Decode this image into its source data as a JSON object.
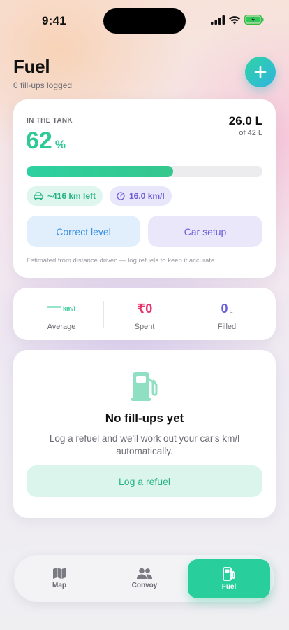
{
  "status_bar": {
    "time": "9:41"
  },
  "header": {
    "title": "Fuel",
    "subtitle": "0 fill-ups logged"
  },
  "tank": {
    "label": "IN THE TANK",
    "percent": "62",
    "percent_unit": "%",
    "liters": "26.0 L",
    "capacity": "of 42 L",
    "fill_fraction": 0.62,
    "range_chip": "~416 km left",
    "efficiency_chip": "16.0 km/l",
    "correct_button": "Correct level",
    "setup_button": "Car setup",
    "note": "Estimated from distance driven — log refuels to keep it accurate."
  },
  "stats": {
    "average": {
      "value": "—",
      "unit": "km/l",
      "label": "Average"
    },
    "spent": {
      "value": "₹0",
      "label": "Spent"
    },
    "filled": {
      "value": "0",
      "unit": "L",
      "label": "Filled"
    }
  },
  "empty_state": {
    "title": "No fill-ups yet",
    "description": "Log a refuel and we'll work out your car's km/l automatically.",
    "button": "Log a refuel"
  },
  "tabs": [
    {
      "label": "Map",
      "icon": "map-icon"
    },
    {
      "label": "Convoy",
      "icon": "people-icon"
    },
    {
      "label": "Fuel",
      "icon": "fuel-pump-icon",
      "active": true
    }
  ],
  "colors": {
    "accent_green": "#2ec994",
    "accent_purple": "#6a5fd6",
    "accent_blue": "#3a8fe0",
    "spent_pink": "#e8336d"
  }
}
